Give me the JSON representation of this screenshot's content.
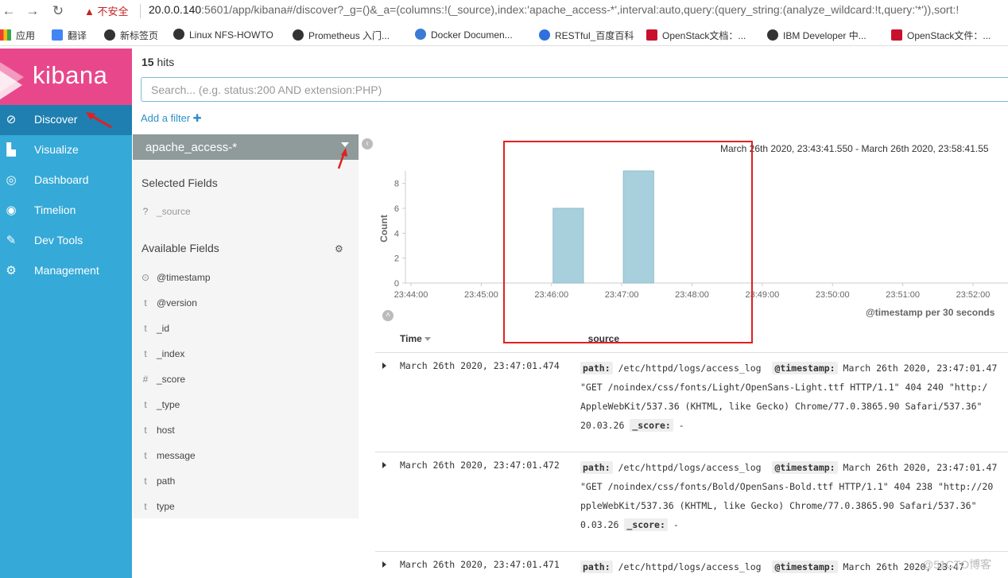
{
  "browser": {
    "back": "←",
    "forward": "→",
    "reload": "↻",
    "security_warning": "不安全",
    "url_host": "20.0.0.140",
    "url_rest": ":5601/app/kibana#/discover?_g=()&_a=(columns:!(_source),index:'apache_access-*',interval:auto,query:(query_string:(analyze_wildcard:!t,query:'*')),sort:!",
    "bookmarks": [
      {
        "label": "应用",
        "color": "#e94235"
      },
      {
        "label": "翻译",
        "color": "#4285f4"
      },
      {
        "label": "新标签页",
        "color": "#333333"
      },
      {
        "label": "Linux NFS-HOWTO",
        "color": "#333333"
      },
      {
        "label": "Prometheus 入门...",
        "color": "#333333"
      },
      {
        "label": "Docker Documen...",
        "color": "#3a7bd5"
      },
      {
        "label": "RESTful_百度百科",
        "color": "#2f6fde"
      },
      {
        "label": "OpenStack文档：...",
        "color": "#c8102e"
      },
      {
        "label": "IBM Developer 中...",
        "color": "#333333"
      },
      {
        "label": "OpenStack文件：...",
        "color": "#c8102e"
      }
    ]
  },
  "kibana": {
    "logo": "kibana",
    "colors": {
      "logo_bg": "#e8488b",
      "sidebar_bg": "#35a9d7",
      "active_bg": "#1e7fb0"
    },
    "nav": [
      {
        "label": "Discover",
        "icon": "compass-icon",
        "active": true
      },
      {
        "label": "Visualize",
        "icon": "bar-chart-icon",
        "active": false
      },
      {
        "label": "Dashboard",
        "icon": "dashboard-icon",
        "active": false
      },
      {
        "label": "Timelion",
        "icon": "timelion-icon",
        "active": false
      },
      {
        "label": "Dev Tools",
        "icon": "wrench-icon",
        "active": false
      },
      {
        "label": "Management",
        "icon": "gear-icon",
        "active": false
      }
    ]
  },
  "query": {
    "hits_count": "15",
    "hits_label": "hits",
    "search_placeholder": "Search... (e.g. status:200 AND extension:PHP)",
    "add_filter": "Add a filter"
  },
  "fields": {
    "index_pattern": "apache_access-*",
    "selected_title": "Selected Fields",
    "selected": [
      {
        "type": "?",
        "name": "_source"
      }
    ],
    "available_title": "Available Fields",
    "available": [
      {
        "type": "clock",
        "name": "@timestamp"
      },
      {
        "type": "t",
        "name": "@version"
      },
      {
        "type": "t",
        "name": "_id"
      },
      {
        "type": "t",
        "name": "_index"
      },
      {
        "type": "#",
        "name": "_score"
      },
      {
        "type": "t",
        "name": "_type"
      },
      {
        "type": "t",
        "name": "host"
      },
      {
        "type": "t",
        "name": "message"
      },
      {
        "type": "t",
        "name": "path"
      },
      {
        "type": "t",
        "name": "type"
      }
    ]
  },
  "chart_data": {
    "type": "bar",
    "title": "",
    "time_range": "March 26th 2020, 23:43:41.550 - March 26th 2020, 23:58:41.55",
    "ylabel": "Count",
    "xlabel": "@timestamp per 30 seconds",
    "ylim": [
      0,
      9
    ],
    "yticks": [
      0,
      2,
      4,
      6,
      8
    ],
    "xticks": [
      "23:44:00",
      "23:45:00",
      "23:46:00",
      "23:47:00",
      "23:48:00",
      "23:49:00",
      "23:50:00",
      "23:51:00",
      "23:52:00"
    ],
    "bars": [
      {
        "start": "23:46:00",
        "end": "23:46:30",
        "value": 6
      },
      {
        "start": "23:47:00",
        "end": "23:47:30",
        "value": 9
      }
    ],
    "bar_color": "#a8cfdc",
    "grid": false
  },
  "table": {
    "col_time": "Time",
    "col_source": "_source",
    "rows": [
      {
        "time": "March 26th 2020, 23:47:01.474",
        "line1_path_key": "path:",
        "line1_path": "/etc/httpd/logs/access_log",
        "line1_ts_key": "@timestamp:",
        "line1_ts": "March 26th 2020, 23:47:01.47",
        "line2": "\"GET /noindex/css/fonts/Light/OpenSans-Light.ttf HTTP/1.1\" 404 240 \"http:/",
        "line3": "AppleWebKit/537.36 (KHTML, like Gecko) Chrome/77.0.3865.90 Safari/537.36\"",
        "line4_pre": "20.03.26",
        "line4_key": "_score:",
        "line4_val": "-"
      },
      {
        "time": "March 26th 2020, 23:47:01.472",
        "line1_path_key": "path:",
        "line1_path": "/etc/httpd/logs/access_log",
        "line1_ts_key": "@timestamp:",
        "line1_ts": "March 26th 2020, 23:47:01.47",
        "line2": "\"GET /noindex/css/fonts/Bold/OpenSans-Bold.ttf HTTP/1.1\" 404 238 \"http://20",
        "line3": "ppleWebKit/537.36 (KHTML, like Gecko) Chrome/77.0.3865.90 Safari/537.36\"",
        "line4_pre": "0.03.26",
        "line4_key": "_score:",
        "line4_val": "-"
      },
      {
        "time": "March 26th 2020, 23:47:01.471",
        "line1_path_key": "path:",
        "line1_path": "/etc/httpd/logs/access_log",
        "line1_ts_key": "@timestamp:",
        "line1_ts": "March 26th 2020, 23:47"
      }
    ]
  },
  "watermark": "@51CTO博客"
}
